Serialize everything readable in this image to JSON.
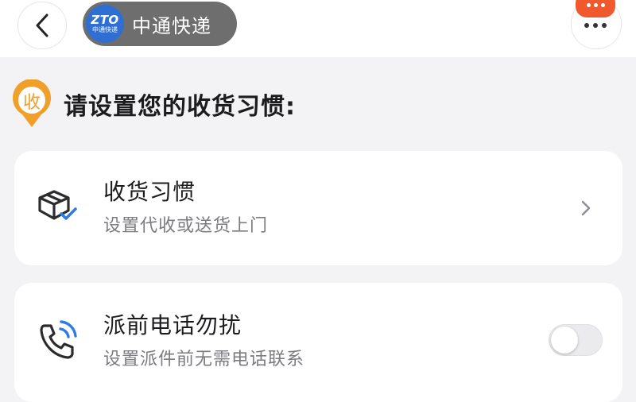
{
  "header": {
    "back_icon": "chevron-left-icon",
    "brand": {
      "logo_text": "ZTO",
      "logo_subtext": "中通快递",
      "name": "中通快递",
      "color": "#2f6fd4"
    },
    "more_icon": "more-dots-icon",
    "badge_color": "#f0592d"
  },
  "section": {
    "pin_label": "收",
    "pin_color": "#f0a02a",
    "title": "请设置您的收货习惯:"
  },
  "settings": [
    {
      "icon": "package-check-icon",
      "title": "收货习惯",
      "subtitle": "设置代收或送货上门",
      "control": "chevron-right-icon"
    },
    {
      "icon": "phone-ringing-icon",
      "title": "派前电话勿扰",
      "subtitle": "设置派件前无需电话联系",
      "control": "toggle",
      "toggle_on": false
    }
  ],
  "colors": {
    "accent_blue": "#2f7be6",
    "text_secondary": "#7b7b80"
  }
}
